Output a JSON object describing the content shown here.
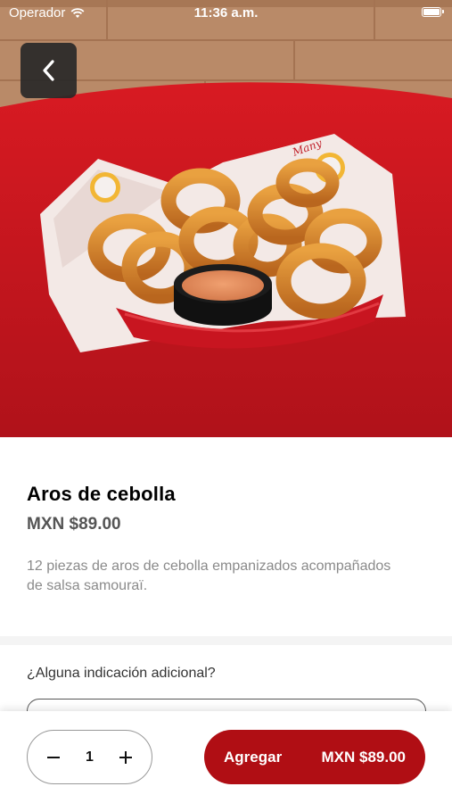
{
  "status_bar": {
    "carrier": "Operador",
    "time": "11:36 a.m."
  },
  "hero": {
    "image_subject": "onion-rings-basket-photo",
    "icon": "back-chevron-icon"
  },
  "product": {
    "title": "Aros de cebolla",
    "price": "MXN $89.00",
    "description": "12 piezas de aros de cebolla empanizados acompañados de salsa samouraï."
  },
  "notes": {
    "label": "¿Alguna indicación adicional?",
    "placeholder": ""
  },
  "cart": {
    "quantity": "1",
    "add_label": "Agregar",
    "add_price": "MXN $89.00"
  },
  "colors": {
    "brand_red": "#b00e14",
    "table_red": "#d31820"
  }
}
